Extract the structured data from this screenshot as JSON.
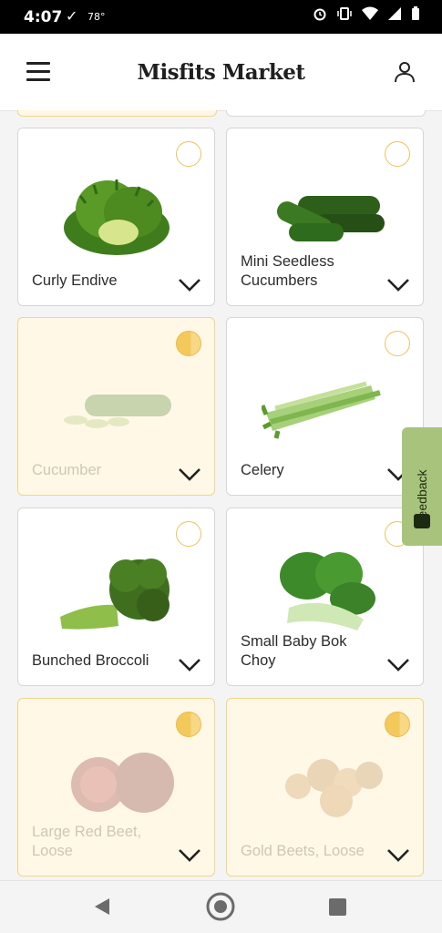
{
  "status_bar": {
    "time": "4:07",
    "temperature": "78°"
  },
  "header": {
    "brand": "Misfits Market",
    "menu_icon": "hamburger-menu-icon",
    "account_icon": "user-icon"
  },
  "products": [
    {
      "name": "Curly Endive",
      "selected": false
    },
    {
      "name": "Mini Seedless Cucumbers",
      "selected": false
    },
    {
      "name": "Cucumber",
      "selected": true
    },
    {
      "name": "Celery",
      "selected": false
    },
    {
      "name": "Bunched Broccoli",
      "selected": false
    },
    {
      "name": "Small Baby Bok Choy",
      "selected": false
    },
    {
      "name": "Large Red Beet, Loose",
      "selected": true
    },
    {
      "name": "Gold Beets, Loose",
      "selected": true
    }
  ],
  "feedback": {
    "label": "Feedback"
  },
  "colors": {
    "accent": "#f3c95c",
    "selected_bg": "#fff8e6",
    "feedback_bg": "#a8c47c"
  }
}
